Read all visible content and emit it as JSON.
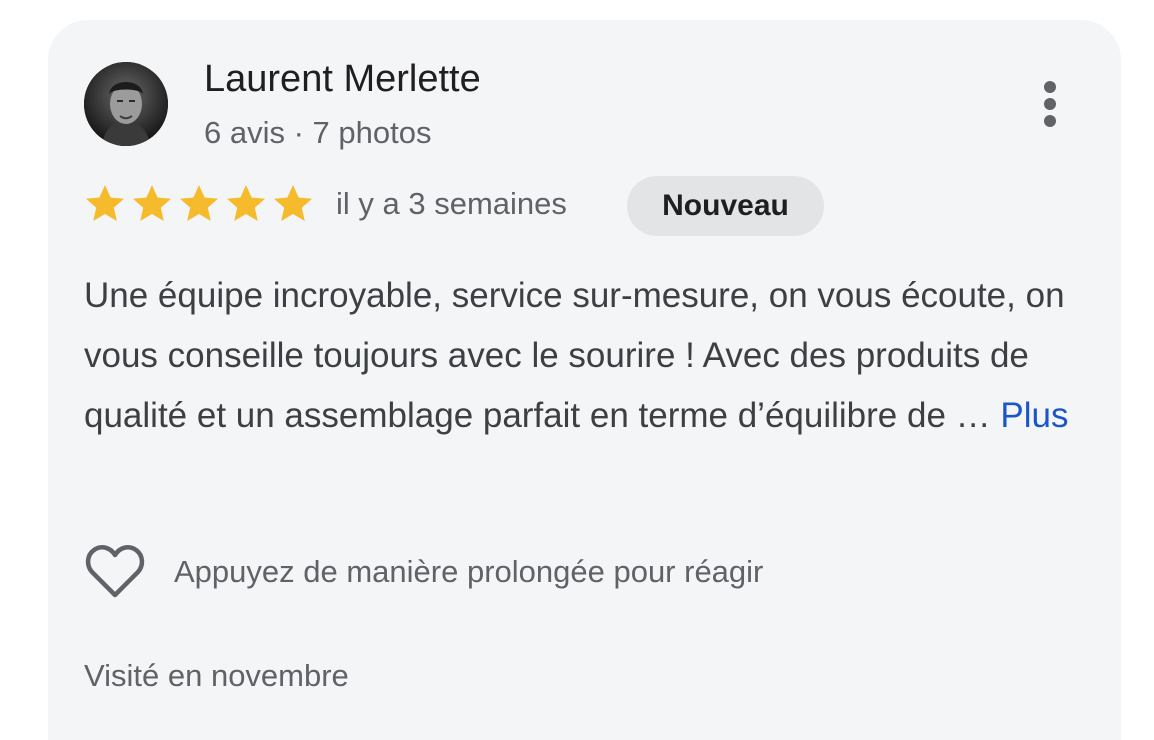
{
  "review": {
    "author": {
      "name": "Laurent Merlette",
      "meta": "6 avis · 7 photos",
      "avatar": "avatar-photo"
    },
    "rating": 5,
    "rating_max": 5,
    "date": "il y a 3 semaines",
    "badge": "Nouveau",
    "text": "Une équipe incroyable, service sur-mesure, on vous écoute, on vous conseille toujours avec le sourire ! Avec des produits de qualité et un assemblage parfait en terme d’équilibre de … ",
    "more_link": "Plus",
    "react_prompt": "Appuyez de manière prolongée pour réagir",
    "visit": "Visité en novembre"
  },
  "icons": {
    "more": "more-vertical-icon",
    "heart": "heart-outline-icon",
    "star": "star-icon"
  },
  "colors": {
    "star": "#f6bb2c",
    "link": "#1a56c9",
    "card_background": "#f4f5f7",
    "badge_background": "#e3e4e6"
  }
}
